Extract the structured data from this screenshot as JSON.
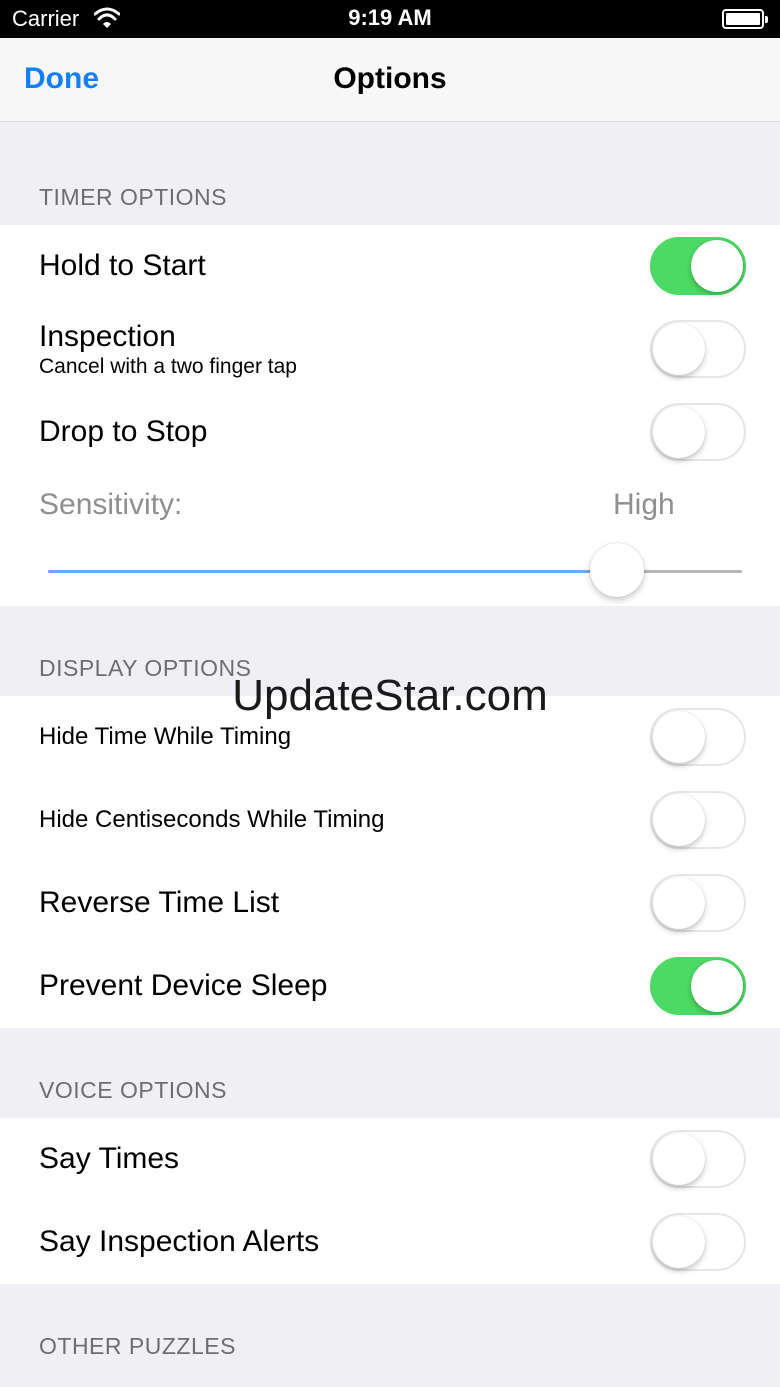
{
  "status_bar": {
    "carrier": "Carrier",
    "time": "9:19 AM",
    "wifi_icon": "wifi-icon",
    "battery_icon": "battery-icon"
  },
  "nav": {
    "done_label": "Done",
    "title": "Options"
  },
  "timer_options": {
    "header": "TIMER OPTIONS",
    "hold_to_start": {
      "label": "Hold to Start",
      "on": true
    },
    "inspection": {
      "label": "Inspection",
      "sublabel": "Cancel with a two finger tap",
      "on": false
    },
    "drop_to_stop": {
      "label": "Drop to Stop",
      "on": false
    },
    "sensitivity": {
      "label": "Sensitivity:",
      "value_label": "High",
      "value_fraction": 0.82
    }
  },
  "display_options": {
    "header": "DISPLAY OPTIONS",
    "hide_time": {
      "label": "Hide Time While Timing",
      "on": false
    },
    "hide_centiseconds": {
      "label": "Hide Centiseconds While Timing",
      "on": false
    },
    "reverse_time_list": {
      "label": "Reverse Time List",
      "on": false
    },
    "prevent_sleep": {
      "label": "Prevent Device Sleep",
      "on": true
    }
  },
  "voice_options": {
    "header": "VOICE OPTIONS",
    "say_times": {
      "label": "Say Times",
      "on": false
    },
    "say_inspection_alerts": {
      "label": "Say Inspection Alerts",
      "on": false
    }
  },
  "other_puzzles": {
    "header": "OTHER PUZZLES"
  },
  "watermark": "UpdateStar.com",
  "colors": {
    "accent": "#147efb",
    "toggle_on": "#4cd964",
    "background": "#efeff4",
    "slider_fill": "#6fa8ef"
  }
}
